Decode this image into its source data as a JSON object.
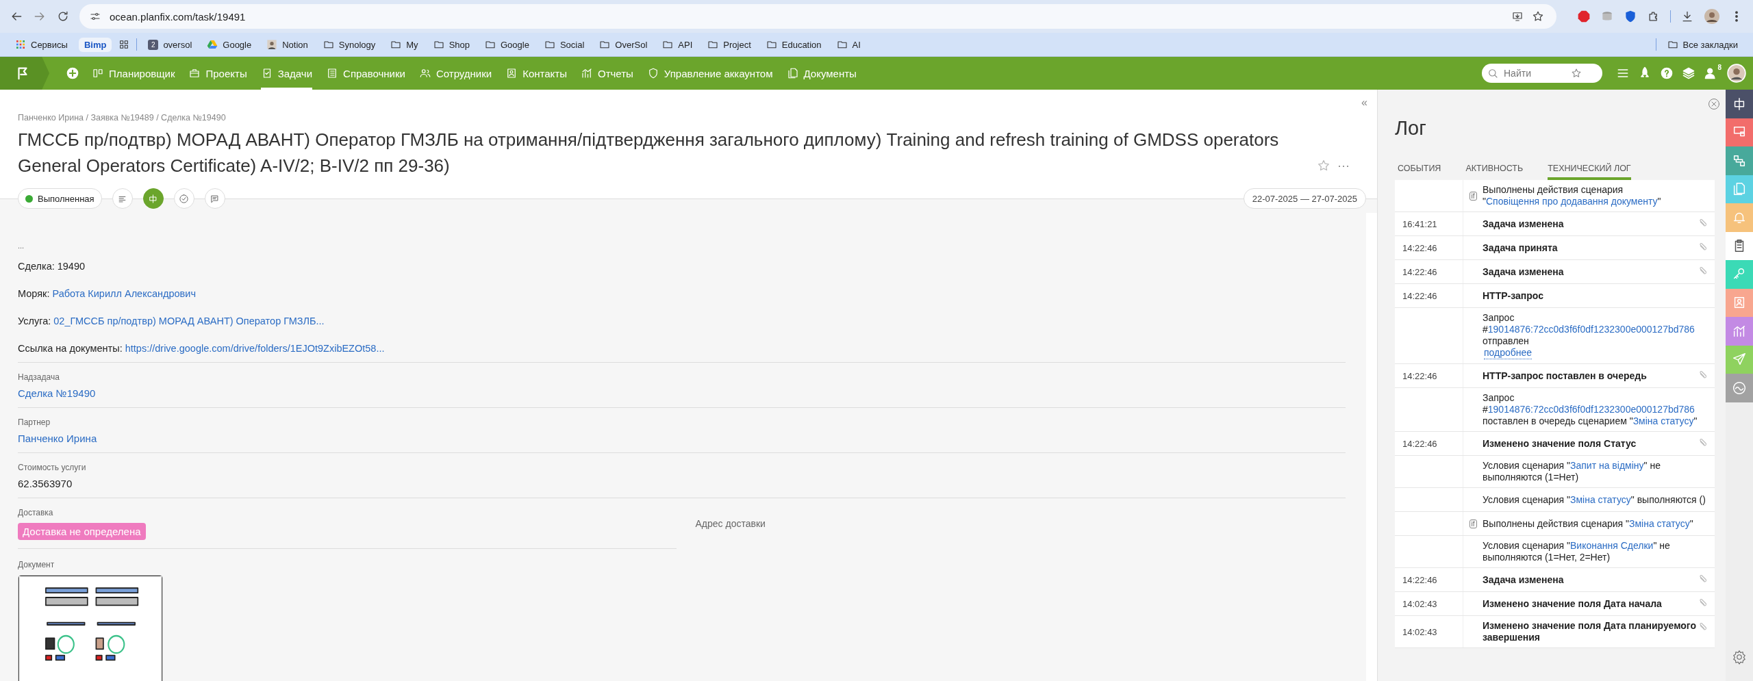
{
  "browser": {
    "url": "ocean.planfix.com/task/19491",
    "bookmarks": [
      {
        "kind": "apps",
        "label": "Сервисы"
      },
      {
        "kind": "chip",
        "label": "Bimp"
      },
      {
        "kind": "grid"
      },
      {
        "kind": "numbered",
        "badge": "2",
        "label": "oversol"
      },
      {
        "kind": "drive",
        "label": "Google"
      },
      {
        "kind": "avatar",
        "label": "Notion"
      },
      {
        "kind": "folder",
        "label": "Synology"
      },
      {
        "kind": "folder",
        "label": "My"
      },
      {
        "kind": "folder",
        "label": "Shop"
      },
      {
        "kind": "folder",
        "label": "Google"
      },
      {
        "kind": "folder",
        "label": "Social"
      },
      {
        "kind": "folder",
        "label": "OverSol"
      },
      {
        "kind": "folder",
        "label": "API"
      },
      {
        "kind": "folder",
        "label": "Project"
      },
      {
        "kind": "folder",
        "label": "Education"
      },
      {
        "kind": "folder",
        "label": "AI"
      }
    ],
    "all_bookmarks": "Все закладки"
  },
  "app_bar": {
    "nav": [
      {
        "kind": "planner",
        "label": "Планировщик",
        "selected": false
      },
      {
        "kind": "projects",
        "label": "Проекты",
        "selected": false
      },
      {
        "kind": "tasks",
        "label": "Задачи",
        "selected": true
      },
      {
        "kind": "directories",
        "label": "Справочники",
        "selected": false
      },
      {
        "kind": "employees",
        "label": "Сотрудники",
        "selected": false
      },
      {
        "kind": "contacts",
        "label": "Контакты",
        "selected": false
      },
      {
        "kind": "reports",
        "label": "Отчеты",
        "selected": false
      },
      {
        "kind": "account",
        "label": "Управление аккаунтом",
        "selected": false
      },
      {
        "kind": "documents",
        "label": "Документы",
        "selected": false
      }
    ],
    "search": {
      "placeholder": "Найти"
    },
    "notifications_count": "8"
  },
  "task": {
    "collapse": "«",
    "breadcrumb": "Панченко Ирина / Заявка №19489 / Сделка №19490",
    "title": "ГМССБ пр/подтвр) МОРАД АВАНТ) Оператор ГМЗЛБ на отримання/підтвердження загального диплому) Training and refresh training of GMDSS operators General Operators Certificate) A-IV/2; B-IV/2 пп 29-36)",
    "more": "···",
    "status": {
      "label": "Выполненная",
      "color": "#3aaa35"
    },
    "actions": [
      {
        "kind": "description",
        "selected": false
      },
      {
        "kind": "phi",
        "selected": true
      },
      {
        "kind": "checklist",
        "selected": false
      },
      {
        "kind": "comments",
        "selected": false
      }
    ],
    "date_range": "22-07-2025 — 27-07-2025",
    "description": {
      "preface": "...",
      "lines": [
        {
          "label": "Сделка:",
          "value": "19490",
          "kind": "text"
        },
        {
          "label": "Моряк:",
          "value": "Работа Кирилл Александрович",
          "kind": "link"
        },
        {
          "label": "Услуга:",
          "value": "02_ГМССБ пр/подтвр) МОРАД АВАНТ) Оператор ГМЗЛБ...",
          "kind": "link"
        },
        {
          "label": "Ссылка на документы:",
          "value": "https://drive.google.com/drive/folders/1EJOt9ZxibEZOt58...",
          "kind": "link"
        }
      ]
    },
    "fields": [
      {
        "label": "Надзадача",
        "value": "Сделка №19490",
        "kind": "link"
      },
      {
        "label": "Партнер",
        "value": "Панченко Ирина",
        "kind": "link"
      },
      {
        "label": "Стоимость услуги",
        "value": "62.3563970",
        "kind": "text"
      },
      {
        "label": "Доставка",
        "value": "Доставка не определена",
        "kind": "tag",
        "color": "#ef7bbf",
        "companion": "Адрес доставки"
      }
    ],
    "document": {
      "label": "Документ",
      "kind": "picture"
    }
  },
  "log": {
    "title": "Лог",
    "tabs": [
      {
        "label": "СОБЫТИЯ",
        "selected": false
      },
      {
        "label": "АКТИВНОСТЬ",
        "selected": false
      },
      {
        "label": "ТЕХНИЧЕСКИЙ ЛОГ",
        "selected": true
      }
    ],
    "entries": [
      {
        "kind": "script",
        "icon_label": "if",
        "parts": [
          {
            "text": "Выполнены действия сценария \""
          },
          {
            "text": "Сповіщення про додавання документу",
            "link": true
          },
          {
            "text": "\""
          }
        ]
      },
      {
        "kind": "event",
        "time": "16:41:21",
        "text": "Задача изменена",
        "attachment": true
      },
      {
        "kind": "event",
        "time": "14:22:46",
        "text": "Задача принята",
        "attachment": true
      },
      {
        "kind": "event",
        "time": "14:22:46",
        "text": "Задача изменена",
        "attachment": true
      },
      {
        "kind": "event",
        "time": "14:22:46",
        "text": "HTTP-запрос",
        "attachment": false
      },
      {
        "kind": "detail",
        "parts": [
          {
            "text": "Запрос #"
          },
          {
            "text": "19014876:72cc0d3f6f0df1232300e000127bd786",
            "link": true
          },
          {
            "text": " отправлен"
          },
          {
            "text": "подробнее",
            "more": true
          }
        ]
      },
      {
        "kind": "event",
        "time": "14:22:46",
        "text": "HTTP-запрос поставлен в очередь",
        "attachment": true
      },
      {
        "kind": "detail",
        "parts": [
          {
            "text": "Запрос #"
          },
          {
            "text": "19014876:72cc0d3f6f0df1232300e000127bd786",
            "link": true
          },
          {
            "text": " поставлен в очередь сценарием \""
          },
          {
            "text": "Зміна статусу",
            "link": true
          },
          {
            "text": "\""
          }
        ]
      },
      {
        "kind": "event",
        "time": "14:22:46",
        "text": "Изменено значение поля Статус",
        "attachment": true
      },
      {
        "kind": "detail",
        "parts": [
          {
            "text": "Условия сценария \""
          },
          {
            "text": "Запит на відміну",
            "link": true
          },
          {
            "text": "\" не выполняются (1=Нет)"
          }
        ]
      },
      {
        "kind": "detail",
        "parts": [
          {
            "text": "Условия сценария \""
          },
          {
            "text": "Зміна статусу",
            "link": true
          },
          {
            "text": "\" выполняются ()"
          }
        ]
      },
      {
        "kind": "script",
        "icon_label": "if",
        "parts": [
          {
            "text": "Выполнены действия сценария \""
          },
          {
            "text": "Зміна статусу",
            "link": true
          },
          {
            "text": "\""
          }
        ]
      },
      {
        "kind": "detail",
        "parts": [
          {
            "text": "Условия сценария \""
          },
          {
            "text": "Виконання Сделки",
            "link": true
          },
          {
            "text": "\" не выполняются (1=Нет, 2=Нет)"
          }
        ]
      },
      {
        "kind": "event",
        "time": "14:22:46",
        "text": "Задача изменена",
        "attachment": true
      },
      {
        "kind": "event",
        "time": "14:02:43",
        "text": "Изменено значение поля Дата начала",
        "attachment": true
      },
      {
        "kind": "event",
        "time": "14:02:43",
        "text": "Изменено значение поля Дата планируемого завершения",
        "attachment": true
      }
    ]
  },
  "sidebar": {
    "items": [
      {
        "kind": "phi",
        "color": "#4b5068",
        "selected": false
      },
      {
        "kind": "screens",
        "color": "#f26d6b",
        "selected": false
      },
      {
        "kind": "swap",
        "color": "#48a99b",
        "selected": false
      },
      {
        "kind": "files",
        "color": "#5cd2e2",
        "selected": false
      },
      {
        "kind": "bell",
        "color": "#f6c27c",
        "selected": false
      },
      {
        "kind": "clipboard",
        "color": "#ffffff",
        "selected": true
      },
      {
        "kind": "key",
        "color": "#3bdab6",
        "selected": false
      },
      {
        "kind": "contact",
        "color": "#f8a68f",
        "selected": false
      },
      {
        "kind": "chart",
        "color": "#c38ae4",
        "selected": false
      },
      {
        "kind": "send",
        "color": "#8fd25f",
        "selected": false
      },
      {
        "kind": "wave",
        "color": "#a2a2a2",
        "selected": false
      }
    ]
  }
}
